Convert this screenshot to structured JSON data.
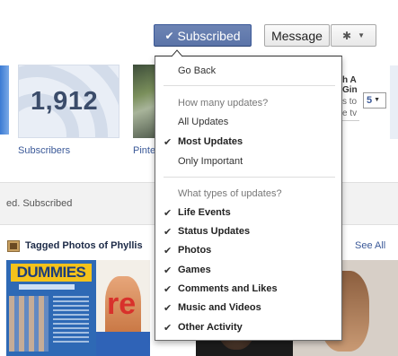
{
  "header": {
    "subscribed_label": "Subscribed",
    "message_label": "Message",
    "gear_icon": "gear-icon",
    "chevron_icon": "chevron-down-icon",
    "check_icon": "check-icon"
  },
  "timeline": {
    "subscribers_count": "1,912",
    "subscribers_label": "Subscribers",
    "pinterest_label": "Pinte",
    "right_card_lines": [
      "h A",
      "Gin",
      "s to",
      "e tv"
    ],
    "number_select_value": "5",
    "status_text": "ed. Subscribed",
    "photos_title": "Tagged Photos of Phyllis",
    "see_all_label": "See All",
    "photo_book_title": "DUMMIES",
    "photo_red_text": "re"
  },
  "menu": {
    "go_back": "Go Back",
    "updates_header": "How many updates?",
    "update_options": [
      {
        "label": "All Updates",
        "checked": false
      },
      {
        "label": "Most Updates",
        "checked": true
      },
      {
        "label": "Only Important",
        "checked": false
      }
    ],
    "types_header": "What types of updates?",
    "type_options": [
      {
        "label": "Life Events",
        "checked": true
      },
      {
        "label": "Status Updates",
        "checked": true
      },
      {
        "label": "Photos",
        "checked": true
      },
      {
        "label": "Games",
        "checked": true
      },
      {
        "label": "Comments and Likes",
        "checked": true
      },
      {
        "label": "Music and Videos",
        "checked": true
      },
      {
        "label": "Other Activity",
        "checked": true
      }
    ]
  },
  "colors": {
    "brand_blue": "#3b5998",
    "button_blue": "#5b74a8",
    "menu_border": "#6b6b6b"
  }
}
